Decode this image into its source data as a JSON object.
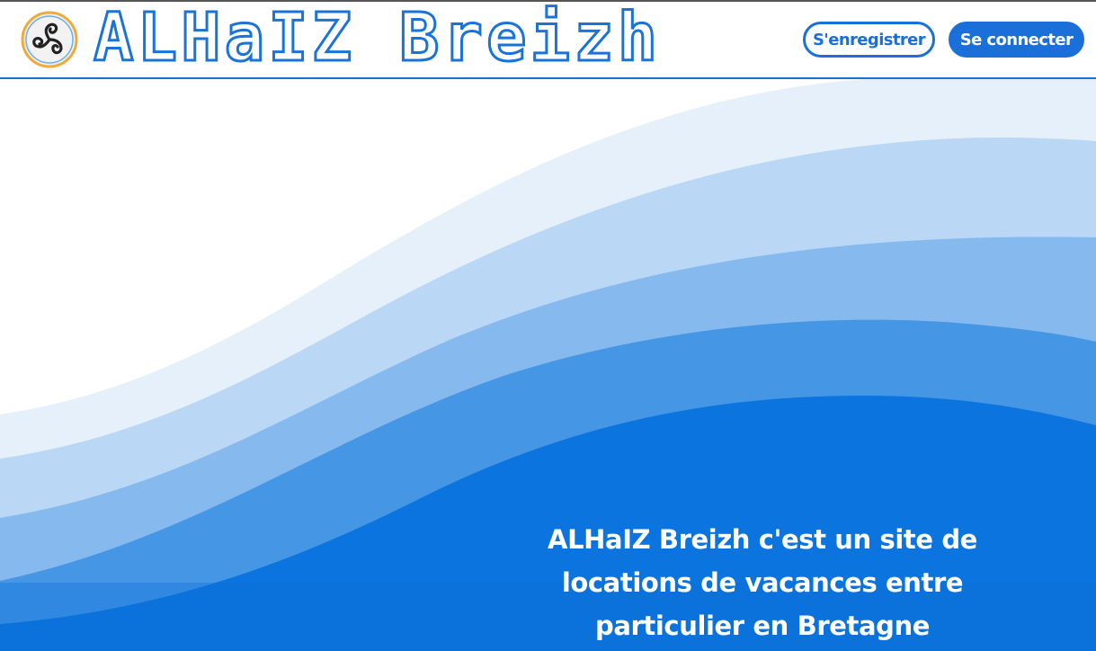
{
  "header": {
    "brand_name": "ALHaIZ Breizh",
    "logo_icon": "triskelion-icon",
    "register_label": "S'enregistrer",
    "login_label": "Se connecter"
  },
  "hero": {
    "tagline": "ALHaIZ Breizh c'est un site de locations de vacances entre particulier en Bretagne"
  },
  "colors": {
    "brand_blue": "#1a6fd8",
    "wave_lightest": "#e6f0fb",
    "wave_light": "#bad8f5",
    "wave_mid": "#86b9ee",
    "wave_strong": "#4696e6",
    "wave_deep": "#0b74de",
    "logo_ring": "#f2a93b"
  }
}
